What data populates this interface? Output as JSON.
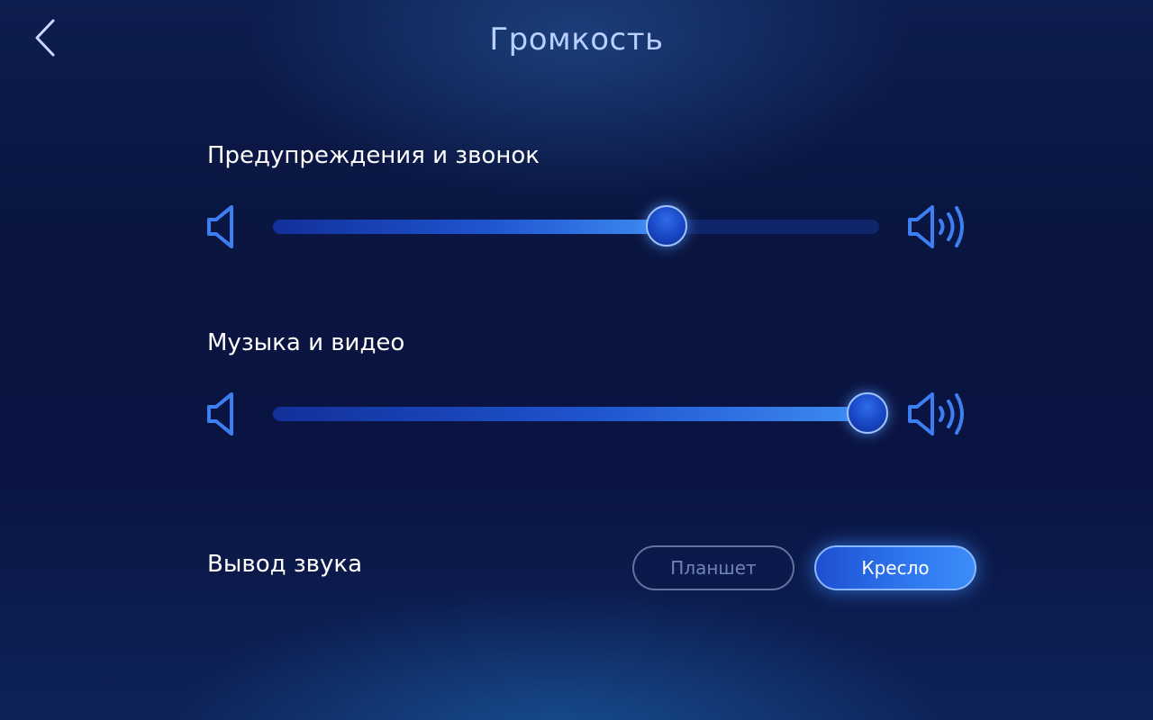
{
  "header": {
    "title": "Громкость",
    "back_icon": "chevron-left-icon"
  },
  "sections": {
    "alerts": {
      "label": "Предупреждения и звонок",
      "level_percent": 65,
      "min_icon": "speaker-icon",
      "max_icon": "speaker-loud-icon"
    },
    "media": {
      "label": "Музыка и видео",
      "level_percent": 98,
      "min_icon": "speaker-icon",
      "max_icon": "speaker-loud-icon"
    }
  },
  "output": {
    "label": "Вывод звука",
    "options": [
      "Планшет",
      "Кресло"
    ],
    "selected": "Кресло"
  },
  "colors": {
    "accent": "#3e8cf2",
    "icon": "#3d7ff0",
    "title": "#b9cfff"
  }
}
